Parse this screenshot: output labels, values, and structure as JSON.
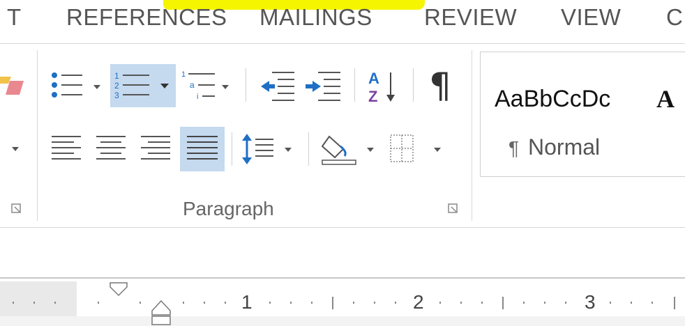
{
  "tabs": [
    "T",
    "REFERENCES",
    "MAILINGS",
    "REVIEW",
    "VIEW",
    "C"
  ],
  "paragraph_group": {
    "label": "Paragraph",
    "sort_label": "A Z",
    "pilcrow": "¶"
  },
  "styles": {
    "sample": "AaBbCcDc",
    "sample2": "A",
    "name": "Normal",
    "pilcrow": "¶"
  },
  "ruler": {
    "numbers": [
      "1",
      "2",
      "3"
    ]
  },
  "colors": {
    "active_button": "#c5d9ef",
    "highlight": "#f5f500",
    "icon_blue": "#1f6fc5",
    "sort_purple": "#7b3fa0"
  }
}
